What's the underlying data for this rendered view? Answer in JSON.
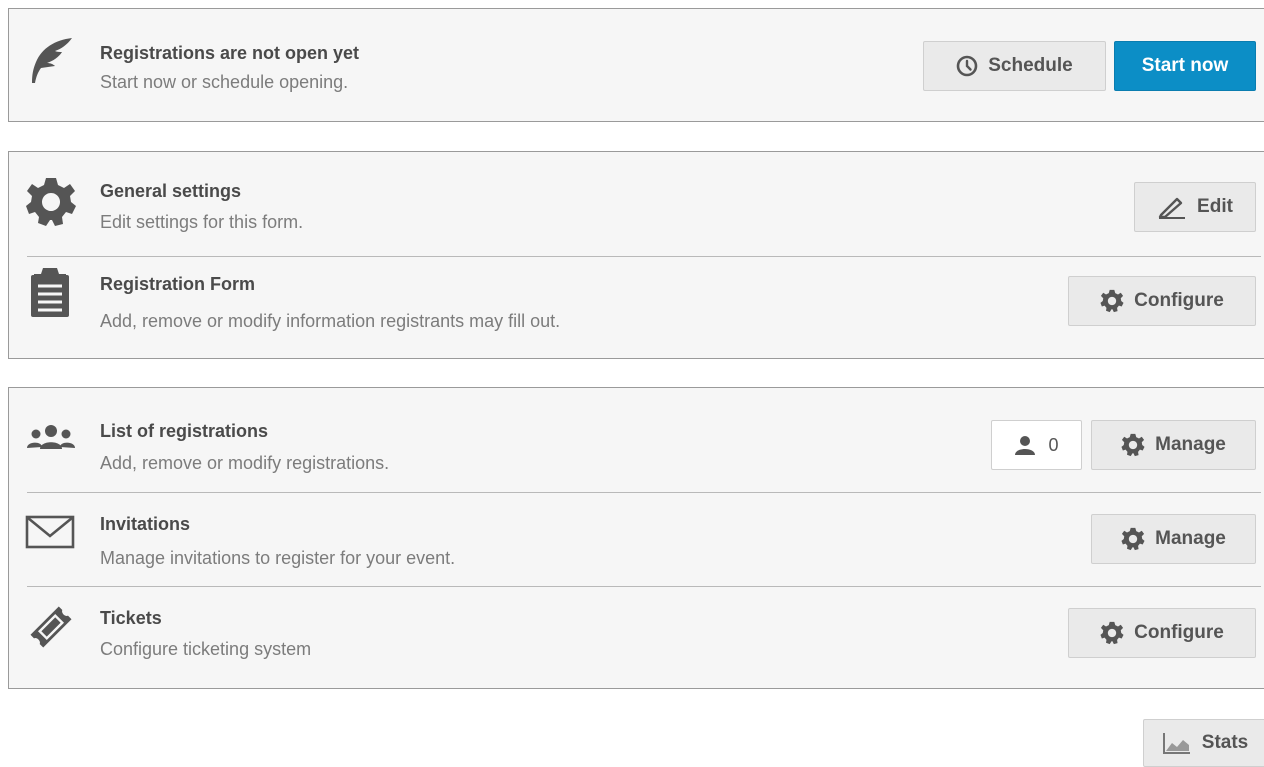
{
  "status": {
    "title": "Registrations are not open yet",
    "description": "Start now or schedule opening.",
    "schedule_label": "Schedule",
    "start_now_label": "Start now",
    "icon": "feather-icon"
  },
  "settings": [
    {
      "title": "General settings",
      "description": "Edit settings for this form.",
      "action_label": "Edit",
      "icon": "gear-icon",
      "action_icon": "pencil-icon"
    },
    {
      "title": "Registration Form",
      "description": "Add, remove or modify information registrants may fill out.",
      "action_label": "Configure",
      "icon": "clipboard-icon",
      "action_icon": "gear-icon"
    }
  ],
  "management": [
    {
      "title": "List of registrations",
      "description": "Add, remove or modify registrations.",
      "action_label": "Manage",
      "count": "0",
      "icon": "users-icon",
      "action_icon": "gear-icon"
    },
    {
      "title": "Invitations",
      "description": "Manage invitations to register for your event.",
      "action_label": "Manage",
      "icon": "envelope-icon",
      "action_icon": "gear-icon"
    },
    {
      "title": "Tickets",
      "description": "Configure ticketing system",
      "action_label": "Configure",
      "icon": "ticket-icon",
      "action_icon": "gear-icon"
    }
  ],
  "footer": {
    "stats_label": "Stats",
    "stats_icon": "chart-icon"
  },
  "colors": {
    "primary": "#0c8ec6",
    "panel_bg": "#f6f6f6",
    "button_bg": "#eaeaea",
    "icon": "#555555"
  }
}
